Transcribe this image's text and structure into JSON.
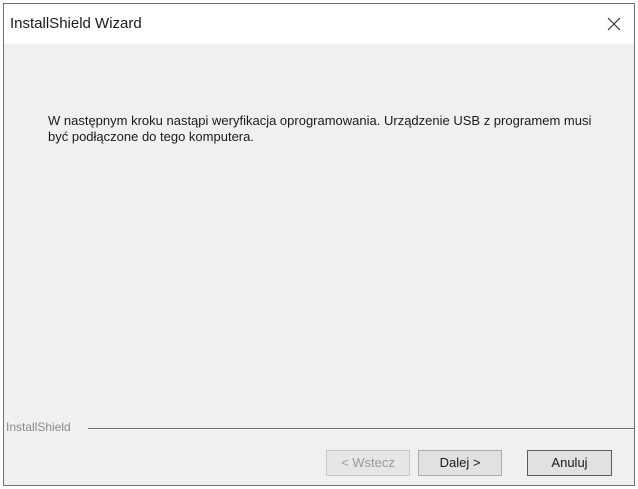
{
  "window": {
    "title": "InstallShield Wizard"
  },
  "content": {
    "message": "W następnym kroku nastąpi weryfikacja oprogramowania. Urządzenie USB z programem musi być podłączone do tego komputera."
  },
  "footer": {
    "brand": "InstallShield",
    "back_label": "< Wstecz",
    "next_label": "Dalej >",
    "cancel_label": "Anuluj"
  },
  "icons": {
    "close": "close-icon"
  }
}
